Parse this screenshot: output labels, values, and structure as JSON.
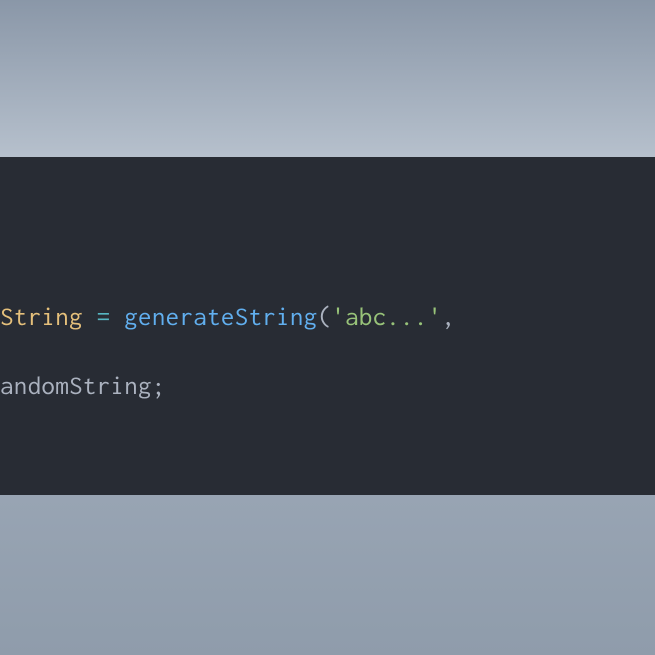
{
  "code": {
    "line1": {
      "varFragment": "String",
      "space1": " ",
      "op": "=",
      "space2": " ",
      "func": "generateString",
      "openParen": "(",
      "str": "'abc...'",
      "comma": ","
    },
    "line2": {
      "fragment": "andomString",
      "semi": ";"
    }
  }
}
